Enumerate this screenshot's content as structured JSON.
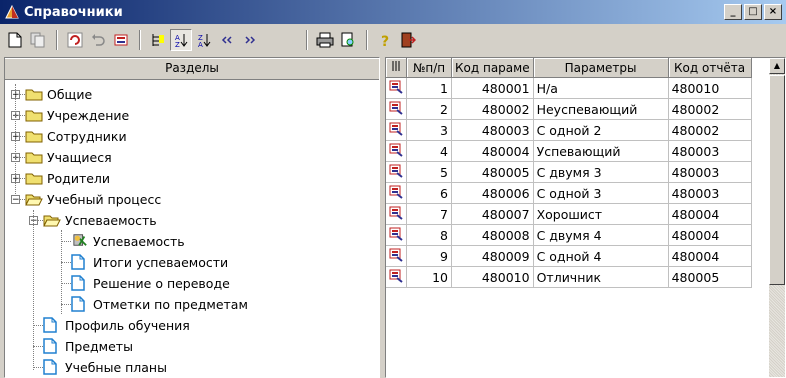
{
  "window": {
    "title": "Справочники",
    "controls": [
      "_",
      "□",
      "×"
    ]
  },
  "toolbar": {
    "buttons": [
      "new-doc-icon",
      "copy-icon",
      "refresh-icon",
      "undo-icon",
      "edit-icon",
      "tree-icon",
      "sort-asc-icon",
      "sort-desc-icon",
      "prev-icon",
      "next-icon",
      "print-icon",
      "preview-icon",
      "help-icon",
      "exit-icon"
    ],
    "accent": "#0a246a"
  },
  "left": {
    "header": "Разделы",
    "tree": [
      {
        "label": "Общие",
        "level": 0,
        "type": "folder",
        "expander": "+"
      },
      {
        "label": "Учреждение",
        "level": 0,
        "type": "folder",
        "expander": "+"
      },
      {
        "label": "Сотрудники",
        "level": 0,
        "type": "folder",
        "expander": "+"
      },
      {
        "label": "Учащиеся",
        "level": 0,
        "type": "folder",
        "expander": "+"
      },
      {
        "label": "Родители",
        "level": 0,
        "type": "folder",
        "expander": "+"
      },
      {
        "label": "Учебный процесс",
        "level": 0,
        "type": "folder-open",
        "expander": "−"
      },
      {
        "label": "Успеваемость",
        "level": 1,
        "type": "folder-open",
        "expander": "−"
      },
      {
        "label": "Успеваемость",
        "level": 2,
        "type": "selected"
      },
      {
        "label": "Итоги успеваемости",
        "level": 2,
        "type": "doc"
      },
      {
        "label": "Решение о переводе",
        "level": 2,
        "type": "doc"
      },
      {
        "label": "Отметки по предметам",
        "level": 2,
        "type": "doc"
      },
      {
        "label": "Профиль обучения",
        "level": 1,
        "type": "doc"
      },
      {
        "label": "Предметы",
        "level": 1,
        "type": "doc"
      },
      {
        "label": "Учебные планы",
        "level": 1,
        "type": "doc"
      }
    ]
  },
  "grid": {
    "columns": [
      "№п/п",
      "Код параме",
      "Параметры",
      "Код отчёта"
    ],
    "rows": [
      [
        "1",
        "480001",
        "Н/а",
        "480010"
      ],
      [
        "2",
        "480002",
        "Неуспевающий",
        "480002"
      ],
      [
        "3",
        "480003",
        "С одной 2",
        "480002"
      ],
      [
        "4",
        "480004",
        "Успевающий",
        "480003"
      ],
      [
        "5",
        "480005",
        "С двумя 3",
        "480003"
      ],
      [
        "6",
        "480006",
        "С одной 3",
        "480003"
      ],
      [
        "7",
        "480007",
        "Хорошист",
        "480004"
      ],
      [
        "8",
        "480008",
        "С двумя 4",
        "480004"
      ],
      [
        "9",
        "480009",
        "С одной 4",
        "480004"
      ],
      [
        "10",
        "480010",
        "Отличник",
        "480005"
      ]
    ]
  }
}
